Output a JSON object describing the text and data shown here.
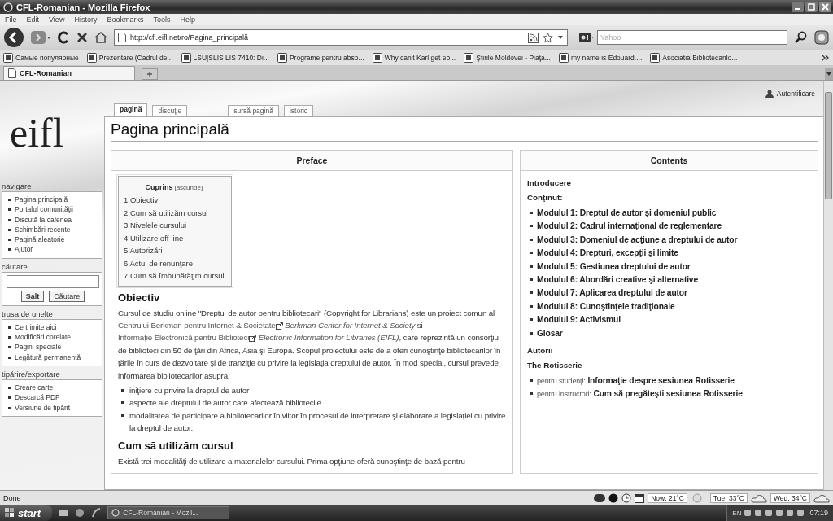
{
  "window": {
    "title": "CFL-Romanian - Mozilla Firefox"
  },
  "menu": [
    "File",
    "Edit",
    "View",
    "History",
    "Bookmarks",
    "Tools",
    "Help"
  ],
  "address": {
    "value": "http://cfl.eifl.net/ro/Pagina_principală"
  },
  "search": {
    "placeholder": "Yahoo"
  },
  "bookmarks": [
    {
      "label": "Самые популярные"
    },
    {
      "label": "Prezentare (Cadrul de..."
    },
    {
      "label": "LSU|SLIS LIS 7410: Di..."
    },
    {
      "label": "Programe pentru abso..."
    },
    {
      "label": "Why can't Karl get eb..."
    },
    {
      "label": "Ştirile Moldovei - Piaţa..."
    },
    {
      "label": "my name is Edouard...."
    },
    {
      "label": "Asociatia Bibliotecarilo..."
    }
  ],
  "browser_tabs": [
    {
      "label": "CFL-Romanian",
      "selected": true
    }
  ],
  "personal": {
    "label": "Autentificare"
  },
  "page_tabs": [
    {
      "label": "pagină",
      "selected": true
    },
    {
      "label": "discuţie",
      "selected": false
    },
    {
      "label": "sursă pagină",
      "selected": false
    },
    {
      "label": "istoric",
      "selected": false
    }
  ],
  "sidebar": {
    "logo": "eifl",
    "portlets": [
      {
        "kind": "links",
        "title": "navigare",
        "items": [
          "Pagina principală",
          "Portalul comunităţii",
          "Discută la cafenea",
          "Schimbări recente",
          "Pagină aleatorie",
          "Ajutor"
        ]
      },
      {
        "kind": "search",
        "title": "căutare",
        "buttons": [
          "Salt",
          "Căutare"
        ]
      },
      {
        "kind": "links",
        "title": "trusa de unelte",
        "items": [
          "Ce trimite aici",
          "Modificări corelate",
          "Pagini speciale",
          "Legătură permanentă"
        ]
      },
      {
        "kind": "links",
        "title": "tipărire/exportare",
        "items": [
          "Creare carte",
          "Descarcă PDF",
          "Versiune de tipărit"
        ]
      }
    ]
  },
  "heading": "Pagina principală",
  "preface": {
    "title": "Preface",
    "blocks": [
      {
        "kind": "toc",
        "title": "Cuprins",
        "toggle": "[ascunde]",
        "items": [
          "1 Obiectiv",
          "2 Cum să utilizăm cursul",
          "3 Nivelele cursului",
          "4 Utilizare off-line",
          "5 Autorizări",
          "6 Actul de renunţare",
          "7 Cum să îmbunătăţim cursul"
        ]
      },
      {
        "kind": "h2",
        "text": "Obiectiv"
      },
      {
        "kind": "paragraph",
        "segments": [
          {
            "kind": "plain",
            "text": "Cursul de studiu online \"Dreptul de autor pentru bibliotecari\" (Copyright for Librarians) este un proiect comun al "
          },
          {
            "kind": "link",
            "text": "Centrului Berkman pentru Internet & Societate"
          },
          {
            "kind": "external",
            "text": "Berkman Center for Internet & Society"
          },
          {
            "kind": "plain",
            "text": " si "
          },
          {
            "kind": "link",
            "text": "Informaţie Electronică pentru Biblioteci"
          },
          {
            "kind": "external",
            "text": "Electronic Information for Libraries (EIFL)"
          },
          {
            "kind": "plain",
            "text": ", care reprezintă un consorţiu de biblioteci din 50 de ţări din Africa, Asia şi Europa. Scopul proiectului este de a oferi cunoştinţe bibliotecarilor în ţările în curs de dezvoltare şi de tranziţie cu privire la legislaţia dreptului de autor. În mod special, cursul prevede informarea bibliotecarilor asupra:"
          }
        ]
      },
      {
        "kind": "bullets",
        "items": [
          "iniţiere cu privire la dreptul de autor",
          "aspecte ale dreptului de autor care afectează bibliotecile",
          "modalitatea de participare a bibliotecarilor în viitor în procesul de interpretare şi elaborare a legislaţiei cu privire la dreptul de autor."
        ]
      },
      {
        "kind": "h2",
        "text": "Cum să utilizăm cursul"
      },
      {
        "kind": "paragraph",
        "segments": [
          {
            "kind": "plain",
            "text": "Există trei modalităţi de utilizare a materialelor cursului. Prima opţiune oferă cunoştinţe de bază pentru"
          }
        ]
      }
    ]
  },
  "contents": {
    "title": "Contents",
    "blocks": [
      {
        "kind": "heading",
        "text": "Introducere"
      },
      {
        "kind": "heading",
        "text": "Conţinut:"
      },
      {
        "kind": "list",
        "items": [
          {
            "text": "Modulul 1: Dreptul de autor şi domeniul public"
          },
          {
            "text": "Modulul 2: Cadrul internaţional de reglementare"
          },
          {
            "text": "Modulul 3: Domeniul de acţiune a dreptului de autor"
          },
          {
            "text": "Modulul 4: Drepturi, excepţii şi limite"
          },
          {
            "text": "Modulul 5: Gestiunea dreptului de autor"
          },
          {
            "text": "Modulul 6: Abordări creative şi alternative"
          },
          {
            "text": "Modulul 7: Aplicarea dreptului de autor"
          },
          {
            "text": "Modulul 8: Cunoştinţele tradiţionale"
          },
          {
            "text": "Modulul 9: Activismul"
          },
          {
            "text": "Glosar"
          }
        ]
      },
      {
        "kind": "heading",
        "text": "Autorii"
      },
      {
        "kind": "heading",
        "text": "The Rotisserie"
      },
      {
        "kind": "list",
        "items": [
          {
            "prefix": "pentru studenţi:",
            "text": "Informaţie despre sesiunea Rotisserie"
          },
          {
            "prefix": "pentru instructori:",
            "text": "Cum să pregăteşti sesiunea Rotisserie"
          }
        ]
      }
    ]
  },
  "status_bar": {
    "text": "Done",
    "weather": [
      "Now: 21°C",
      "Tue: 33°C",
      "Wed: 34°C"
    ]
  },
  "taskbar": {
    "start": "start",
    "tasks": [
      "CFL-Romanian - Mozil..."
    ],
    "language": "EN",
    "clock": "07:19"
  }
}
